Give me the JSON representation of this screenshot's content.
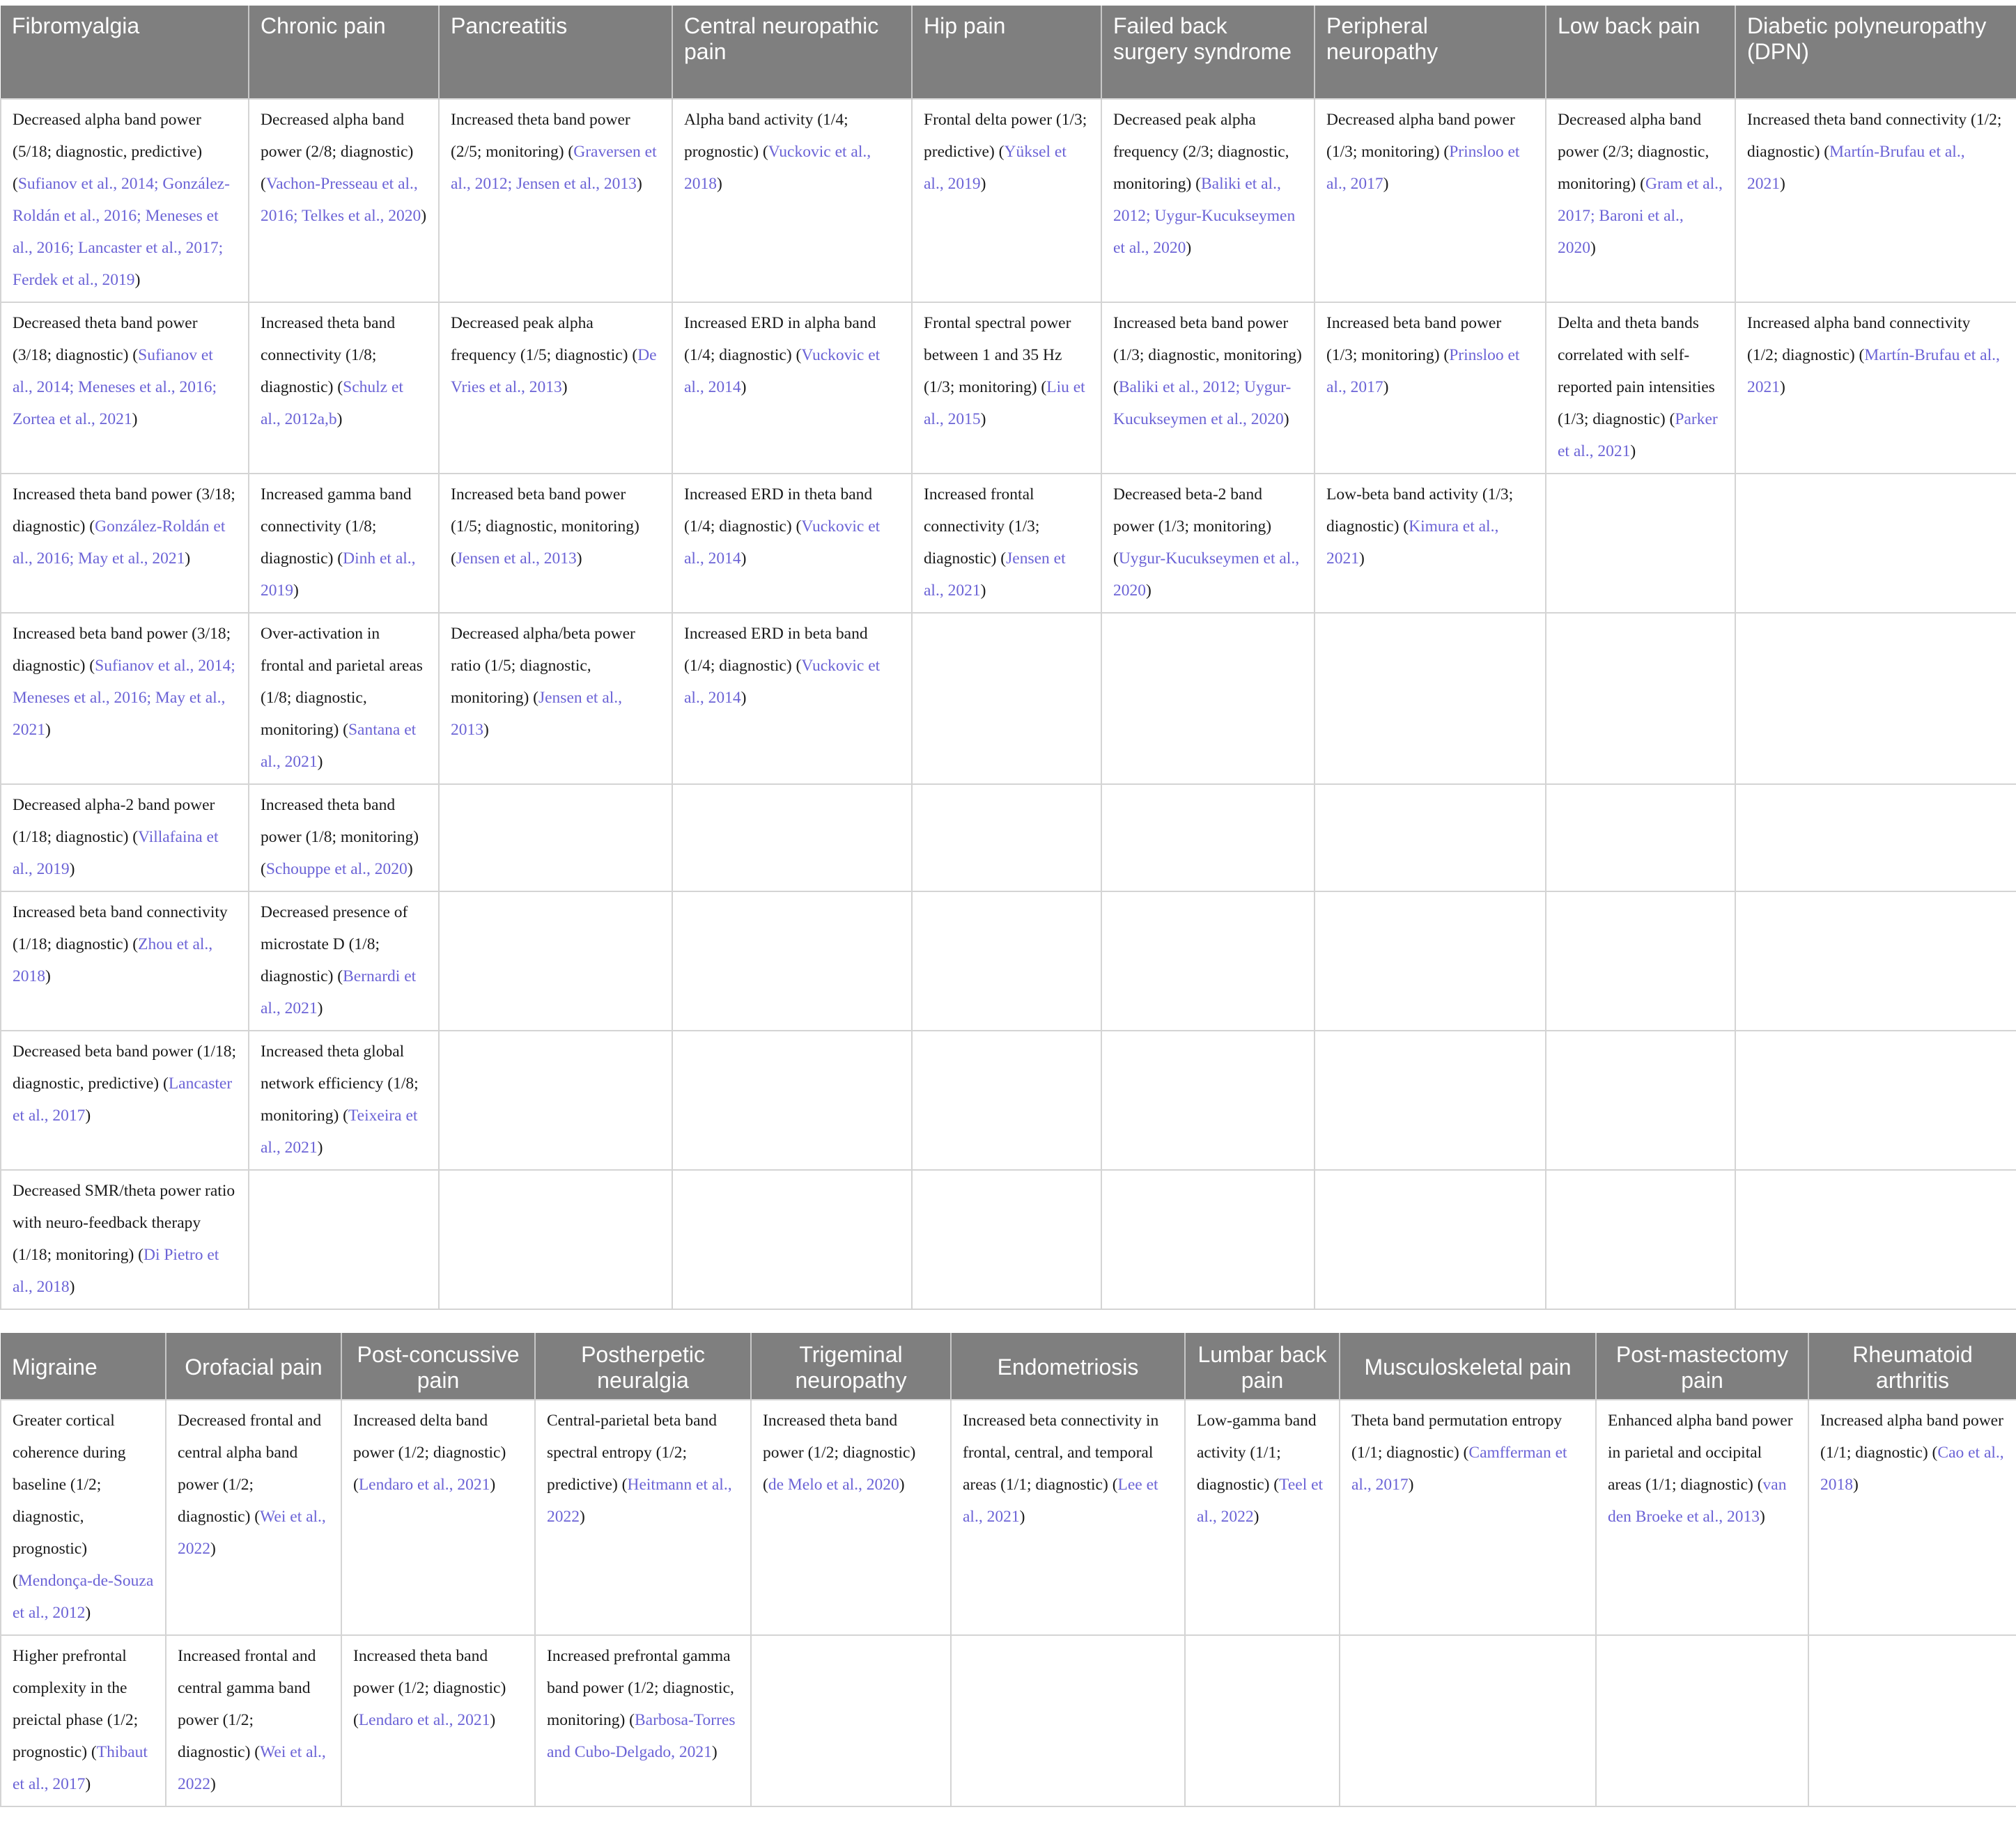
{
  "table1": {
    "headers": [
      "Fibromyalgia",
      "Chronic pain",
      "Pancreatitis",
      "Central neuropathic pain",
      "Hip pain",
      "Failed back surgery syndrome",
      "Peripheral neuropathy",
      "Low back pain",
      "Diabetic polyneuropathy (DPN)"
    ],
    "rows": [
      [
        {
          "text": "Decreased alpha band power (5/18; diagnostic, predictive) (",
          "ref": "Sufianov et al., 2014; González-Roldán et al., 2016; Meneses et al., 2016; Lancaster et al., 2017; Ferdek et al., 2019",
          "end": ")"
        },
        {
          "text": "Decreased alpha band power (2/8; diagnostic) (",
          "ref": "Vachon-Presseau et al., 2016; Telkes et al., 2020",
          "end": ")"
        },
        {
          "text": "Increased theta band power (2/5; monitoring) (",
          "ref": "Graversen et al., 2012; Jensen et al., 2013",
          "end": ")"
        },
        {
          "text": "Alpha band activity (1/4; prognostic) (",
          "ref": "Vuckovic et al., 2018",
          "end": ")"
        },
        {
          "text": "Frontal delta power (1/3; predictive) (",
          "ref": "Yüksel et al., 2019",
          "end": ")"
        },
        {
          "text": "Decreased peak alpha frequency (2/3; diagnostic, monitoring) (",
          "ref": "Baliki et al., 2012; Uygur-Kucukseymen et al., 2020",
          "end": ")"
        },
        {
          "text": "Decreased alpha band power (1/3; monitoring) (",
          "ref": "Prinsloo et al., 2017",
          "end": ")"
        },
        {
          "text": "Decreased alpha band power (2/3; diagnostic, monitoring) (",
          "ref": "Gram et al., 2017; Baroni et al., 2020",
          "end": ")"
        },
        {
          "text": "Increased theta band connectivity (1/2; diagnostic) (",
          "ref": "Martín-Brufau et al., 2021",
          "end": ")"
        }
      ],
      [
        {
          "text": "Decreased theta band power (3/18; diagnostic) (",
          "ref": "Sufianov et al., 2014; Meneses et al., 2016; Zortea et al., 2021",
          "end": ")"
        },
        {
          "text": "Increased theta band connectivity (1/8; diagnostic) (",
          "ref": "Schulz et al., 2012a,b",
          "end": ")"
        },
        {
          "text": "Decreased peak alpha frequency (1/5; diagnostic) (",
          "ref": "De Vries et al., 2013",
          "end": ")"
        },
        {
          "text": "Increased ERD in alpha band (1/4; diagnostic) (",
          "ref": "Vuckovic et al., 2014",
          "end": ")"
        },
        {
          "text": "Frontal spectral power between 1 and 35 Hz (1/3; monitoring) (",
          "ref": "Liu et al., 2015",
          "end": ")"
        },
        {
          "text": "Increased beta band power (1/3; diagnostic, monitoring) (",
          "ref": "Baliki et al., 2012; Uygur-Kucukseymen et al., 2020",
          "end": ")"
        },
        {
          "text": "Increased beta band power (1/3; monitoring) (",
          "ref": "Prinsloo et al., 2017",
          "end": ")"
        },
        {
          "text": "Delta and theta bands correlated with self-reported pain intensities (1/3; diagnostic) (",
          "ref": "Parker et al., 2021",
          "end": ")"
        },
        {
          "text": "Increased alpha band connectivity (1/2; diagnostic) (",
          "ref": "Martín-Brufau et al., 2021",
          "end": ")"
        }
      ],
      [
        {
          "text": "Increased theta band power (3/18; diagnostic) (",
          "ref": "González-Roldán et al., 2016; May et al., 2021",
          "end": ")"
        },
        {
          "text": "Increased gamma band connectivity (1/8; diagnostic) (",
          "ref": "Dinh et al., 2019",
          "end": ")"
        },
        {
          "text": "Increased beta band power (1/5; diagnostic, monitoring) (",
          "ref": "Jensen et al., 2013",
          "end": ")"
        },
        {
          "text": "Increased ERD in theta band (1/4; diagnostic) (",
          "ref": "Vuckovic et al., 2014",
          "end": ")"
        },
        {
          "text": "Increased frontal connectivity (1/3; diagnostic) (",
          "ref": "Jensen et al., 2021",
          "end": ")"
        },
        {
          "text": "Decreased beta-2 band power (1/3; monitoring) (",
          "ref": "Uygur-Kucukseymen et al., 2020",
          "end": ")"
        },
        {
          "text": "Low-beta band activity (1/3; diagnostic) (",
          "ref": "Kimura et al., 2021",
          "end": ")"
        },
        null,
        null
      ],
      [
        {
          "text": "Increased beta band power (3/18; diagnostic) (",
          "ref": "Sufianov et al., 2014; Meneses et al., 2016; May et al., 2021",
          "end": ")"
        },
        {
          "text": "Over-activation in frontal and parietal areas (1/8; diagnostic, monitoring) (",
          "ref": "Santana et al., 2021",
          "end": ")"
        },
        {
          "text": "Decreased alpha/beta power ratio (1/5; diagnostic, monitoring) (",
          "ref": "Jensen et al., 2013",
          "end": ")"
        },
        {
          "text": "Increased ERD in beta band (1/4; diagnostic) (",
          "ref": "Vuckovic et al., 2014",
          "end": ")"
        },
        null,
        null,
        null,
        null,
        null
      ],
      [
        {
          "text": "Decreased alpha-2 band power (1/18; diagnostic) (",
          "ref": "Villafaina et al., 2019",
          "end": ")"
        },
        {
          "text": "Increased theta band power (1/8; monitoring) (",
          "ref": "Schouppe et al., 2020",
          "end": ")"
        },
        null,
        null,
        null,
        null,
        null,
        null,
        null
      ],
      [
        {
          "text": "Increased beta band connectivity (1/18; diagnostic) (",
          "ref": "Zhou et al., 2018",
          "end": ")"
        },
        {
          "text": "Decreased presence of microstate D (1/8; diagnostic) (",
          "ref": "Bernardi et al., 2021",
          "end": ")"
        },
        null,
        null,
        null,
        null,
        null,
        null,
        null
      ],
      [
        {
          "text": "Decreased beta band power (1/18; diagnostic, predictive) (",
          "ref": "Lancaster et al., 2017",
          "end": ")"
        },
        {
          "text": "Increased theta global network efficiency (1/8; monitoring) (",
          "ref": "Teixeira et al., 2021",
          "end": ")"
        },
        null,
        null,
        null,
        null,
        null,
        null,
        null
      ],
      [
        {
          "text": "Decreased SMR/theta power ratio with neuro-feedback therapy (1/18; monitoring) (",
          "ref": "Di Pietro et al., 2018",
          "end": ")"
        },
        null,
        null,
        null,
        null,
        null,
        null,
        null,
        null
      ]
    ]
  },
  "table2": {
    "headers": [
      "Migraine",
      "Orofacial pain",
      "Post-concussive pain",
      "Postherpetic neuralgia",
      "Trigeminal neuropathy",
      "Endometriosis",
      "Lumbar back pain",
      "Musculoskeletal pain",
      "Post-mastectomy pain",
      "Rheumatoid arthritis"
    ],
    "rows": [
      [
        {
          "text": "Greater cortical coherence during baseline (1/2; diagnostic, prognostic) (",
          "ref": "Mendonça-de-Souza et al., 2012",
          "end": ")"
        },
        {
          "text": "Decreased frontal and central alpha band power (1/2; diagnostic) (",
          "ref": "Wei et al., 2022",
          "end": ")"
        },
        {
          "text": "Increased delta band power (1/2; diagnostic) (",
          "ref": "Lendaro et al., 2021",
          "end": ")"
        },
        {
          "text": "Central-parietal beta band spectral entropy (1/2; predictive) (",
          "ref": "Heitmann et al., 2022",
          "end": ")"
        },
        {
          "text": "Increased theta band power (1/2; diagnostic) (",
          "ref": "de Melo et al., 2020",
          "end": ")"
        },
        {
          "text": "Increased beta connectivity in frontal, central, and temporal areas (1/1; diagnostic) (",
          "ref": "Lee et al., 2021",
          "end": ")"
        },
        {
          "text": "Low-gamma band activity (1/1; diagnostic) (",
          "ref": "Teel et al., 2022",
          "end": ")"
        },
        {
          "text": "Theta band permutation entropy (1/1; diagnostic) (",
          "ref": "Camfferman et al., 2017",
          "end": ")"
        },
        {
          "text": "Enhanced alpha band power in parietal and occipital areas (1/1; diagnostic) (",
          "ref": "van den Broeke et al., 2013",
          "end": ")"
        },
        {
          "text": "Increased alpha band power (1/1; diagnostic) (",
          "ref": "Cao et al., 2018",
          "end": ")"
        }
      ],
      [
        {
          "text": "Higher prefrontal complexity in the preictal phase (1/2; prognostic) (",
          "ref": "Thibaut et al., 2017",
          "end": ")"
        },
        {
          "text": "Increased frontal and central gamma band power (1/2; diagnostic) (",
          "ref": "Wei et al., 2022",
          "end": ")"
        },
        {
          "text": "Increased theta band power (1/2; diagnostic) (",
          "ref": "Lendaro et al., 2021",
          "end": ")"
        },
        {
          "text": "Increased prefrontal gamma band power (1/2; diagnostic, monitoring) (",
          "ref": "Barbosa-Torres and Cubo-Delgado, 2021",
          "end": ")"
        },
        null,
        null,
        null,
        null,
        null,
        null
      ]
    ]
  }
}
